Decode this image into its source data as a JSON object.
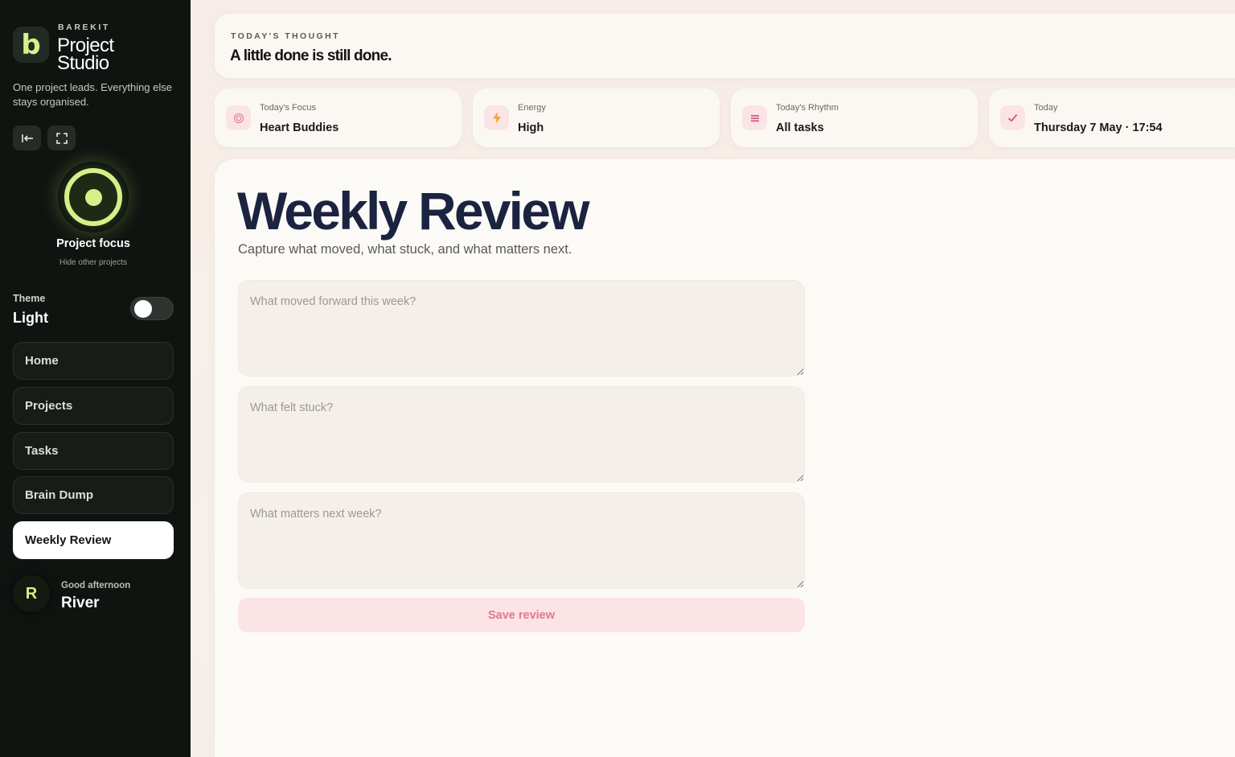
{
  "sidebar": {
    "logo_letter": "b",
    "brand_kicker": "BAREKIT",
    "brand_title": "Project Studio",
    "brand_subtitle": "One project leads. Everything else stays organised.",
    "collapse_icon": "collapse-sidebar-icon",
    "expand_icon": "fullscreen-icon",
    "focus_label": "Project focus",
    "focus_hint": "Hide other projects",
    "theme_label": "Theme",
    "theme_value": "Light",
    "theme_toggle_on": false,
    "nav": [
      {
        "label": "Home",
        "active": false
      },
      {
        "label": "Projects",
        "active": false
      },
      {
        "label": "Tasks",
        "active": false
      },
      {
        "label": "Brain Dump",
        "active": false
      },
      {
        "label": "Weekly Review",
        "active": true
      }
    ],
    "user": {
      "avatar_letter": "R",
      "greeting": "Good afternoon",
      "name": "River"
    }
  },
  "thought": {
    "kicker": "TODAY'S THOUGHT",
    "text": "A little done is still done."
  },
  "stats": [
    {
      "icon": "target-icon",
      "label": "Today's Focus",
      "value": "Heart Buddies"
    },
    {
      "icon": "lightning-icon",
      "label": "Energy",
      "value": "High"
    },
    {
      "icon": "list-icon",
      "label": "Today's Rhythm",
      "value": "All tasks"
    },
    {
      "icon": "checkmark-icon",
      "label": "Today",
      "value": "Thursday 7 May · 17:54"
    }
  ],
  "review": {
    "title": "Weekly Review",
    "subtitle": "Capture what moved, what stuck, and what matters next.",
    "fields": [
      {
        "placeholder": "What moved forward this week?",
        "value": ""
      },
      {
        "placeholder": "What felt stuck?",
        "value": ""
      },
      {
        "placeholder": "What matters next week?",
        "value": ""
      }
    ],
    "save_label": "Save review"
  },
  "colors": {
    "sidebar_bg": "#101411",
    "accent_lime": "#d6ef88",
    "accent_pink": "#e07793",
    "title_navy": "#1b2341"
  }
}
